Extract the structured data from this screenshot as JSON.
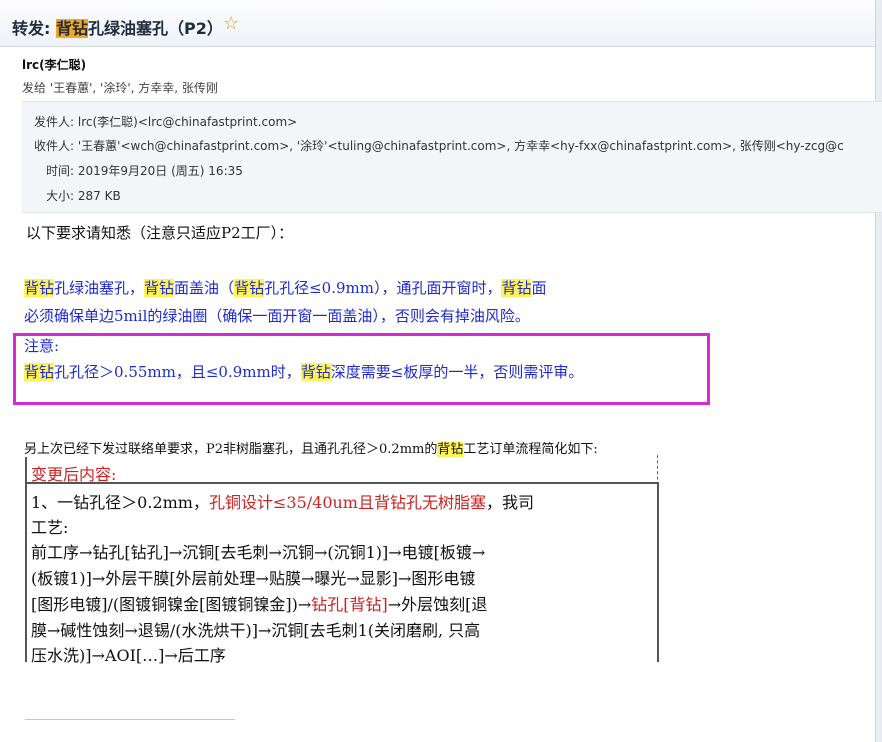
{
  "subject": {
    "prefix": "转发: ",
    "highlight": "背钻",
    "rest": "孔绿油塞孔（P2）"
  },
  "sender": {
    "name": "lrc(李仁聪)",
    "sendto": "发给 '王春蕙', '涂玲', 方幸幸, 张传刚"
  },
  "header": {
    "from": "发件人: lrc(李仁聪)<lrc@chinafastprint.com>",
    "to": "收件人: '王春蕙'<wch@chinafastprint.com>, '涂玲'<tuling@chinafastprint.com>, 方幸幸<hy-fxx@chinafastprint.com>, 张传刚<hy-zcg@c",
    "time": "时间: 2019年9月20日 (周五) 16:35",
    "size": "大小: 287 KB"
  },
  "body": {
    "intro": "以下要求请知悉（注意只适应P2工厂）：",
    "para1_l1": [
      "背钻",
      "孔绿油塞孔，",
      "背钻",
      "面盖油（",
      "背钻",
      "孔孔径≤0.9mm），通孔面开窗时，",
      "背钻",
      "面"
    ],
    "para1_l2": "必须确保单边5mil的绿油圈（确保一面开窗一面盖油），否则会有掉油风险。",
    "note_label": "注意:",
    "note_l1": [
      "背钻",
      "孔孔径＞0.55mm，且≤0.9mm时，",
      "背钻",
      "深度需要≤板厚的一半，否则需评审。"
    ],
    "para2": [
      "另上次已经下发过联络单要求，P2非树脂塞孔，且通孔孔径＞0.2mm的",
      "背钻",
      "工艺订单流程简化如下:"
    ],
    "changed_label": "变更后内容:",
    "table": {
      "l1a": "1、一钻孔径＞0.2mm，",
      "l1b": "孔铜设计≤35/40um且背钻孔无树脂塞",
      "l1c": "，我司",
      "l2": "工艺:",
      "l3": "前工序→钻孔[钻孔]→沉铜[去毛刺→沉铜→(沉铜1)]→电镀[板镀→",
      "l4": "(板镀1)]→外层干膜[外层前处理→贴膜→曝光→显影]→图形电镀",
      "l5a": "[图形电镀]/(图镀铜镍金[图镀铜镍金])→",
      "l5b": "钻孔[背钻]",
      "l5c": "→外层蚀刻[退",
      "l6": "膜→碱性蚀刻→退锡/(水洗烘干)]→沉铜[去毛刺1(关闭磨刷, 只高",
      "l7": "压水洗)]→AOI[…]→后工序"
    }
  },
  "colors": {
    "accent": "#1f2bd1",
    "highlight": "#fff35a",
    "tag": "#f5a623",
    "box": "#d52ad8",
    "red": "#cc2222"
  }
}
